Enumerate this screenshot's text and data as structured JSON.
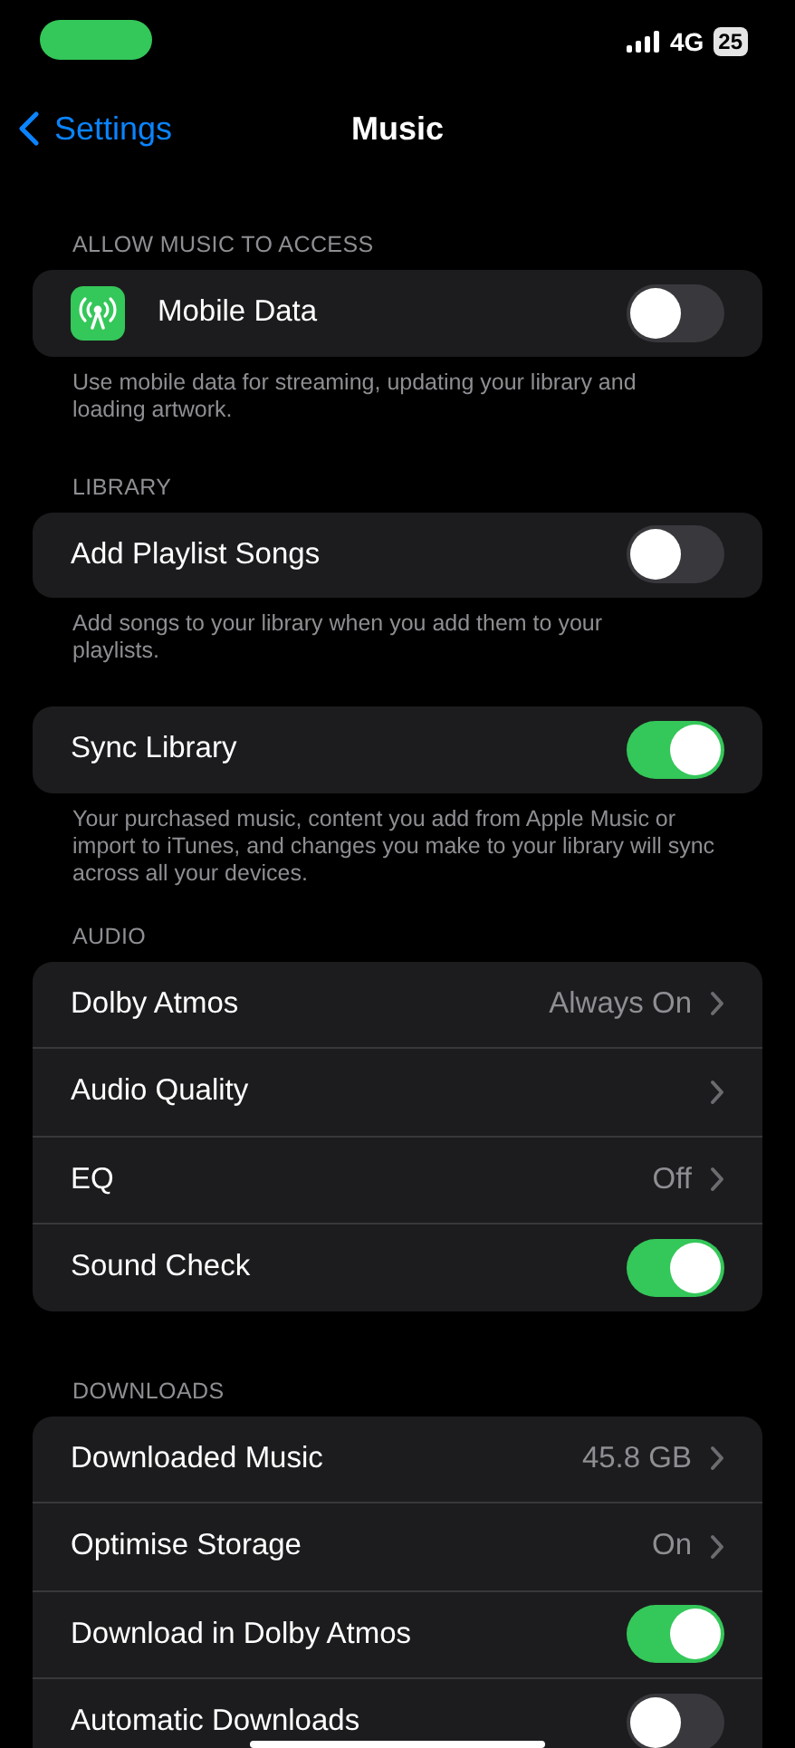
{
  "status_bar": {
    "network": "4G",
    "battery": "25"
  },
  "nav": {
    "back": "Settings",
    "title": "Music"
  },
  "sections": [
    {
      "header": "ALLOW MUSIC TO ACCESS",
      "rows": [
        {
          "kind": "toggle",
          "label": "Mobile Data",
          "on": false
        }
      ],
      "footer": "Use mobile data for streaming, updating your library and loading artwork."
    },
    {
      "header": "LIBRARY",
      "rows": [
        {
          "kind": "toggle",
          "label": "Add Playlist Songs",
          "on": false
        }
      ],
      "footer": "Add songs to your library when you add them to your playlists."
    },
    {
      "rows": [
        {
          "kind": "toggle",
          "label": "Sync Library",
          "on": true
        }
      ],
      "footer": "Your purchased music, content you add from Apple Music or import to iTunes, and changes you make to your library will sync across all your devices."
    },
    {
      "header": "AUDIO",
      "rows": [
        {
          "kind": "value",
          "label": "Dolby Atmos",
          "value": "Always On"
        },
        {
          "kind": "chevron",
          "label": "Audio Quality"
        },
        {
          "kind": "value",
          "label": "EQ",
          "value": "Off"
        },
        {
          "kind": "toggle",
          "label": "Sound Check",
          "on": true
        }
      ]
    },
    {
      "header": "DOWNLOADS",
      "rows": [
        {
          "kind": "value",
          "label": "Downloaded Music",
          "value": "45.8 GB"
        },
        {
          "kind": "value",
          "label": "Optimise Storage",
          "value": "On"
        },
        {
          "kind": "toggle",
          "label": "Download in Dolby Atmos",
          "on": true
        },
        {
          "kind": "toggle",
          "label": "Automatic Downloads",
          "on": false
        }
      ]
    }
  ]
}
